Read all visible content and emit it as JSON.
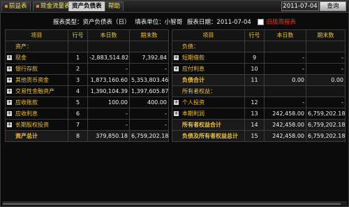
{
  "tabs": [
    {
      "label": "损益表",
      "active": false
    },
    {
      "label": "现金流量表",
      "active": false
    },
    {
      "label": "资产负债表",
      "active": true
    },
    {
      "label": "帮助",
      "active": false
    }
  ],
  "date_value": "2011-07-04",
  "query_label": "查询",
  "meta": {
    "type_label": "报表类型：资产负债表（日）",
    "unit_label": "填表单位：小智哥",
    "date_label": "报表日期：2011-07-04",
    "prev_label": "旧版周报表"
  },
  "headers": {
    "item": "项目",
    "row": "行号",
    "current": "本日数",
    "end": "期末数"
  },
  "left_rows": [
    {
      "item": "资产：",
      "no": "",
      "cur": "",
      "end": "",
      "kind": "section",
      "plus": false
    },
    {
      "item": "现金",
      "no": "1",
      "cur": "-2,883,514.82",
      "end": "7,392.84",
      "kind": "row",
      "plus": true
    },
    {
      "item": "银行存款",
      "no": "2",
      "cur": "-",
      "end": "-",
      "kind": "row",
      "plus": true
    },
    {
      "item": "其他货币资金",
      "no": "3",
      "cur": "1,873,160.60",
      "end": "5,353,803.46",
      "kind": "row",
      "plus": true
    },
    {
      "item": "交易性金融资产",
      "no": "4",
      "cur": "1,390,104.39",
      "end": "1,397,605.87",
      "kind": "row",
      "plus": true
    },
    {
      "item": "应收账款",
      "no": "5",
      "cur": "100.00",
      "end": "400.00",
      "kind": "row",
      "plus": true
    },
    {
      "item": "应收利息",
      "no": "6",
      "cur": "-",
      "end": "-",
      "kind": "row",
      "plus": true
    },
    {
      "item": "长期股权投资",
      "no": "7",
      "cur": "-",
      "end": "-",
      "kind": "row",
      "plus": true
    },
    {
      "item": "资产总计",
      "no": "8",
      "cur": "379,850.18",
      "end": "6,759,202.18",
      "kind": "total",
      "plus": false
    }
  ],
  "right_rows": [
    {
      "item": "负债：",
      "no": "",
      "cur": "",
      "end": "",
      "kind": "section",
      "plus": false
    },
    {
      "item": "短期借款",
      "no": "9",
      "cur": "-",
      "end": "-",
      "kind": "row",
      "plus": true
    },
    {
      "item": "应付利息",
      "no": "10",
      "cur": "-",
      "end": "-",
      "kind": "row",
      "plus": true
    },
    {
      "item": "负债合计",
      "no": "11",
      "cur": "0.00",
      "end": "0.00",
      "kind": "total",
      "plus": false
    },
    {
      "item": "所有者权益：",
      "no": "",
      "cur": "",
      "end": "",
      "kind": "section",
      "plus": false
    },
    {
      "item": "个人投资",
      "no": "12",
      "cur": "-",
      "end": "-",
      "kind": "row",
      "plus": true
    },
    {
      "item": "本期利润",
      "no": "13",
      "cur": "242,458.00",
      "end": "6,759,202.18",
      "kind": "row",
      "plus": true
    },
    {
      "item": "所有者权益合计",
      "no": "14",
      "cur": "242,458.00",
      "end": "6,759,202.18",
      "kind": "total",
      "plus": false
    },
    {
      "item": "负债及所有者权益总计",
      "no": "15",
      "cur": "242,458.00",
      "end": "6,759,202.18",
      "kind": "total",
      "plus": false
    }
  ]
}
